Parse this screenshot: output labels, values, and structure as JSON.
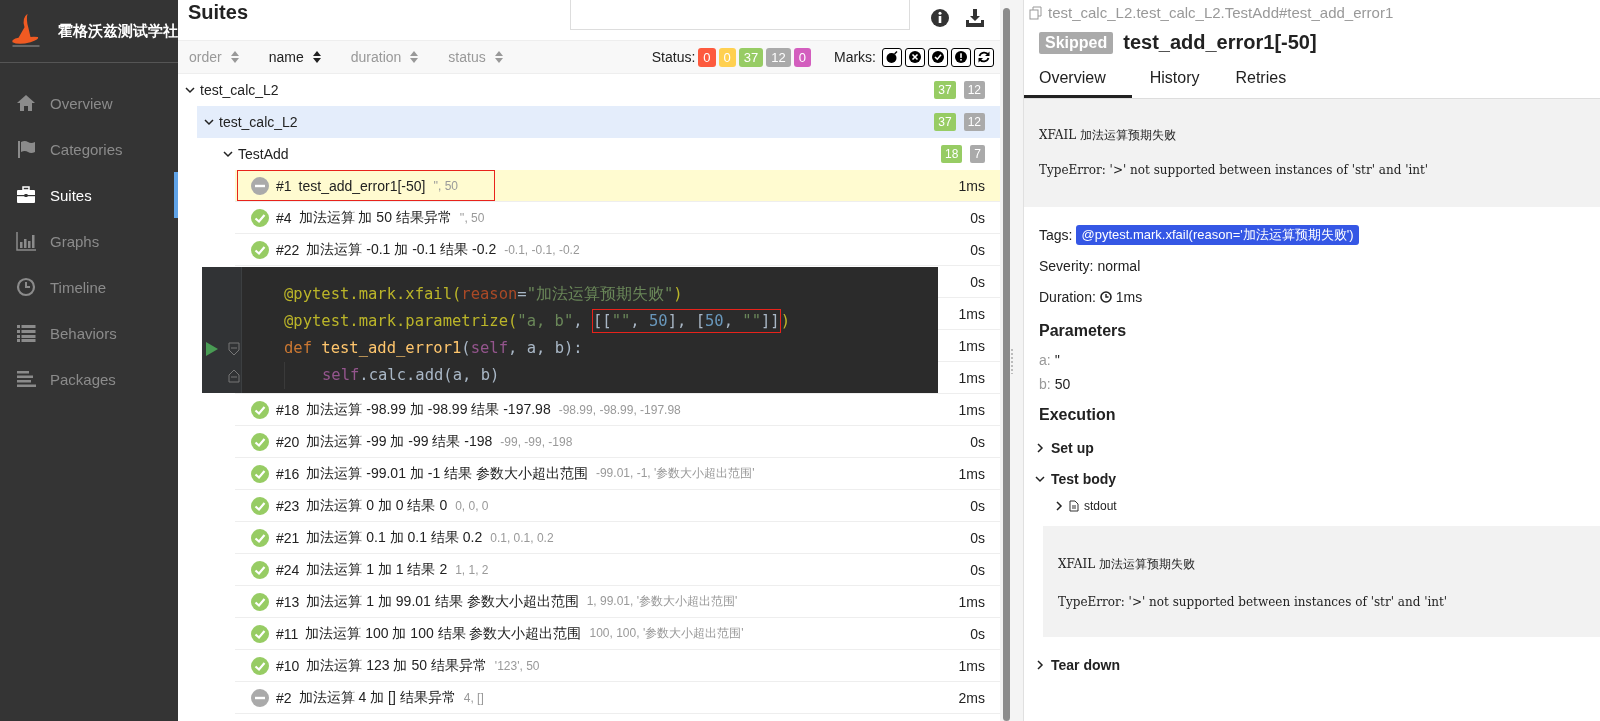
{
  "brand": {
    "title": "霍格沃兹测试学社"
  },
  "sidebar": {
    "items": [
      {
        "label": "Overview",
        "selected": false
      },
      {
        "label": "Categories",
        "selected": false
      },
      {
        "label": "Suites",
        "selected": true
      },
      {
        "label": "Graphs",
        "selected": false
      },
      {
        "label": "Timeline",
        "selected": false
      },
      {
        "label": "Behaviors",
        "selected": false
      },
      {
        "label": "Packages",
        "selected": false
      }
    ]
  },
  "suites": {
    "title": "Suites",
    "sort_columns": [
      {
        "label": "order",
        "selected": false
      },
      {
        "label": "name",
        "selected": true
      },
      {
        "label": "duration",
        "selected": false
      },
      {
        "label": "status",
        "selected": false
      }
    ],
    "status_filter": {
      "label": "Status:",
      "counts": [
        {
          "value": "0",
          "color": "#fd5a3e"
        },
        {
          "value": "0",
          "color": "#ffd050"
        },
        {
          "value": "37",
          "color": "#97cc64"
        },
        {
          "value": "12",
          "color": "#aaaaaa"
        },
        {
          "value": "0",
          "color": "#d35ebe"
        }
      ]
    },
    "marks": {
      "label": "Marks:",
      "items": [
        {
          "kind": "bomb"
        },
        {
          "kind": "times"
        },
        {
          "kind": "check"
        },
        {
          "kind": "exclamation"
        },
        {
          "kind": "refresh"
        }
      ]
    },
    "tree": [
      {
        "name": "test_calc_L2",
        "expanded": true,
        "selected": false,
        "counts": [
          {
            "value": "37",
            "color": "#97cc64"
          },
          {
            "value": "12",
            "color": "#aaaaaa"
          }
        ],
        "children": [
          {
            "name": "test_calc_L2",
            "expanded": true,
            "selected": true,
            "counts": [
              {
                "value": "37",
                "color": "#97cc64"
              },
              {
                "value": "12",
                "color": "#aaaaaa"
              }
            ],
            "children": [
              {
                "name": "TestAdd",
                "expanded": true,
                "selected": false,
                "counts": [
                  {
                    "value": "18",
                    "color": "#97cc64"
                  },
                  {
                    "value": "7",
                    "color": "#aaaaaa"
                  }
                ],
                "tests": [
                  {
                    "number": "#1",
                    "name": "test_add_error1[-50]",
                    "params": "'', 50",
                    "duration": "1ms",
                    "kind": "skipped",
                    "selected": true,
                    "annotated": true
                  },
                  {
                    "number": "#4",
                    "name": "加法运算 加 50 结果异常",
                    "params": "'', 50",
                    "duration": "0s",
                    "kind": "passed",
                    "selected": false,
                    "annotated": false
                  },
                  {
                    "number": "#22",
                    "name": "加法运算 -0.1 加 -0.1 结果 -0.2",
                    "params": "-0.1, -0.1, -0.2",
                    "duration": "0s",
                    "kind": "passed",
                    "selected": false,
                    "annotated": false
                  },
                  {
                    "duration": "0s"
                  },
                  {
                    "duration": "1ms"
                  },
                  {
                    "duration": "1ms"
                  },
                  {
                    "duration": "1ms"
                  },
                  {
                    "number": "#18",
                    "name": "加法运算 -98.99 加 -98.99 结果 -197.98",
                    "params": "-98.99, -98.99, -197.98",
                    "duration": "1ms",
                    "kind": "passed",
                    "selected": false,
                    "annotated": false
                  },
                  {
                    "number": "#20",
                    "name": "加法运算 -99 加 -99 结果 -198",
                    "params": "-99, -99, -198",
                    "duration": "0s",
                    "kind": "passed",
                    "selected": false,
                    "annotated": false
                  },
                  {
                    "number": "#16",
                    "name": "加法运算 -99.01 加 -1 结果 参数大小超出范围",
                    "params": "-99.01, -1, '参数大小超出范围'",
                    "duration": "1ms",
                    "kind": "passed",
                    "selected": false,
                    "annotated": false
                  },
                  {
                    "number": "#23",
                    "name": "加法运算 0 加 0 结果 0",
                    "params": "0, 0, 0",
                    "duration": "0s",
                    "kind": "passed",
                    "selected": false,
                    "annotated": false
                  },
                  {
                    "number": "#21",
                    "name": "加法运算 0.1 加 0.1 结果 0.2",
                    "params": "0.1, 0.1, 0.2",
                    "duration": "0s",
                    "kind": "passed",
                    "selected": false,
                    "annotated": false
                  },
                  {
                    "number": "#24",
                    "name": "加法运算 1 加 1 结果 2",
                    "params": "1, 1, 2",
                    "duration": "0s",
                    "kind": "passed",
                    "selected": false,
                    "annotated": false
                  },
                  {
                    "number": "#13",
                    "name": "加法运算 1 加 99.01 结果 参数大小超出范围",
                    "params": "1, 99.01, '参数大小超出范围'",
                    "duration": "1ms",
                    "kind": "passed",
                    "selected": false,
                    "annotated": false
                  },
                  {
                    "number": "#11",
                    "name": "加法运算 100 加 100 结果 参数大小超出范围",
                    "params": "100, 100, '参数大小超出范围'",
                    "duration": "0s",
                    "kind": "passed",
                    "selected": false,
                    "annotated": false
                  },
                  {
                    "number": "#10",
                    "name": "加法运算 123 加 50 结果异常",
                    "params": "'123', 50",
                    "duration": "1ms",
                    "kind": "passed",
                    "selected": false,
                    "annotated": false
                  },
                  {
                    "number": "#2",
                    "name": "加法运算 4 加 [] 结果异常",
                    "params": "4, []",
                    "duration": "2ms",
                    "kind": "skipped",
                    "selected": false,
                    "annotated": false
                  }
                ]
              }
            ]
          }
        ]
      }
    ]
  },
  "code_overlay": {
    "lines": [
      {
        "tokens": [
          {
            "t": "@pytest.mark.xfail(",
            "kind": "decorator"
          },
          {
            "t": "reason",
            "kind": "param"
          },
          {
            "t": "=",
            "kind": "plain"
          },
          {
            "t": "\"加法运算预期失败\"",
            "kind": "string"
          },
          {
            "t": ")",
            "kind": "decorator"
          }
        ]
      },
      {
        "tokens": [
          {
            "t": "@pytest.mark.parametrize(",
            "kind": "decorator"
          },
          {
            "t": "\"a, b\"",
            "kind": "string"
          },
          {
            "t": ", ",
            "kind": "plain"
          },
          {
            "box": [
              {
                "t": "[[",
                "kind": "plain"
              },
              {
                "t": "\"\"",
                "kind": "string"
              },
              {
                "t": ", ",
                "kind": "plain"
              },
              {
                "t": "50",
                "kind": "number"
              },
              {
                "t": "], [",
                "kind": "plain"
              },
              {
                "t": "50",
                "kind": "number"
              },
              {
                "t": ", ",
                "kind": "plain"
              },
              {
                "t": "\"\"",
                "kind": "string"
              },
              {
                "t": "]]",
                "kind": "plain"
              }
            ]
          },
          {
            "t": ")",
            "kind": "decorator"
          }
        ]
      },
      {
        "runnable": true,
        "tokens": [
          {
            "t": "def ",
            "kind": "keyword"
          },
          {
            "t": "test_add_error1",
            "kind": "function"
          },
          {
            "t": "(",
            "kind": "plain"
          },
          {
            "t": "self",
            "kind": "self"
          },
          {
            "t": ", a, b):",
            "kind": "plain"
          }
        ],
        "children": [
          {
            "tokens": [
              {
                "t": "self",
                "kind": "self"
              },
              {
                "t": ".calc.add(a, b)",
                "kind": "plain"
              }
            ]
          }
        ]
      }
    ]
  },
  "detail": {
    "path": "test_calc_L2.test_calc_L2.TestAdd#test_add_error1",
    "status": {
      "label": "Skipped",
      "kind": "skipped"
    },
    "title": "test_add_error1[-50]",
    "tabs": [
      {
        "label": "Overview",
        "selected": true
      },
      {
        "label": "History",
        "selected": false
      },
      {
        "label": "Retries",
        "selected": false
      }
    ],
    "message": [
      "XFAIL 加法运算预期失败",
      "TypeError: '>' not supported between instances of 'str' and 'int'"
    ],
    "tags": {
      "label": "Tags:",
      "items": [
        "@pytest.mark.xfail(reason='加法运算预期失败')"
      ]
    },
    "severity": {
      "label": "Severity:",
      "value": "normal"
    },
    "duration": {
      "label": "Duration:",
      "value": "1ms"
    },
    "parameters": {
      "title": "Parameters",
      "items": [
        {
          "name": "a:",
          "value": "''"
        },
        {
          "name": "b:",
          "value": "50"
        }
      ]
    },
    "execution": {
      "title": "Execution",
      "steps": [
        {
          "name": "Set up",
          "expanded": false
        },
        {
          "name": "Test body",
          "expanded": true,
          "attachments": [
            {
              "name": "stdout",
              "expanded": false
            }
          ],
          "output": [
            "XFAIL 加法运算预期失败",
            "TypeError: '>' not supported between instances of 'str' and 'int'"
          ]
        },
        {
          "name": "Tear down",
          "expanded": false
        }
      ]
    }
  }
}
